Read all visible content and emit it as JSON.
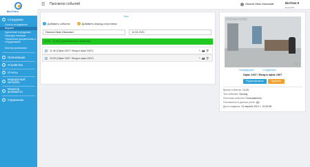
{
  "app": {
    "logo_text": "BioTime",
    "page_title": "Просмотр событий"
  },
  "user": {
    "name": "Иванов Иван Иванович"
  },
  "org": {
    "name": "BioTime 8",
    "line1": "",
    "line2": "Demo-PC"
  },
  "sidebar": {
    "items": [
      {
        "label": "Сотрудники",
        "icon": "users-icon"
      },
      {
        "label": "Организации",
        "icon": "building-icon"
      },
      {
        "label": "Устройства",
        "icon": "device-icon"
      },
      {
        "label": "Отчеты",
        "icon": "report-icon"
      },
      {
        "label": "Маршрутный контроль",
        "icon": "route-icon"
      },
      {
        "label": "Монитор активности",
        "icon": "monitor-icon"
      },
      {
        "label": "Управление",
        "icon": "gear-icon"
      }
    ],
    "subitems": [
      {
        "label": "Список сотрудников"
      },
      {
        "label": "Журнал",
        "active": true
      },
      {
        "label": "Удаленные сотрудники"
      },
      {
        "label": "Периоды отпусков"
      },
      {
        "label": "Управление документами и сотрудниками"
      },
      {
        "label": "Мастер расписания"
      }
    ],
    "colors": {
      "bg": "#2e9fdb",
      "active": "#1f7cb6"
    }
  },
  "main": {
    "tab_all": "Все",
    "add_event": "Добавить событие",
    "add_absence": "Добавить период отсутствия",
    "employee_value": "Иванов Иван Иванович",
    "date_value": "12.04.2021",
    "group_header": "12.04 - 11:46 (Отработанный с вычетом)",
    "group_color": "#20c920",
    "events": [
      {
        "time": "11:46",
        "text": "(Офис 2407 / Вход в офис 2407)"
      },
      {
        "time": "13:25",
        "text": "(Офис 2407 / Вход в офис 2407)",
        "selected": true
      }
    ]
  },
  "detail": {
    "cam_label_tl": "ФЗ-02-2021 13:25:58",
    "cam_label_br": "Wall",
    "prev": "Предыдущее",
    "next": "Следующее",
    "caption": "Офис 2407 / Вход в офис 2407",
    "edit_button": "Редактировать",
    "delete_button": "Удалить",
    "rows": [
      {
        "label": "Время события:",
        "value": "13:25"
      },
      {
        "label": "Тип события:",
        "value": "Проход"
      },
      {
        "label": "Источник события:",
        "value": "Пользователь"
      },
      {
        "label": "Поставлено в ручном учете:",
        "value": "Да"
      },
      {
        "label": "Дата создания:",
        "value": "12 апреля 2021 г. 13:25:58"
      }
    ]
  }
}
